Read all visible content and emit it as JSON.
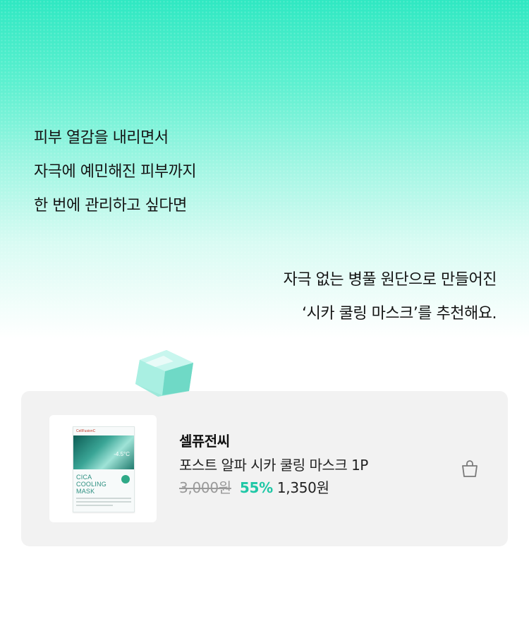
{
  "intro": {
    "line1": "피부 열감을 내리면서",
    "line2": "자극에 예민해진 피부까지",
    "line3": "한 번에 관리하고 싶다면"
  },
  "outro": {
    "line1": "자극 없는 병풀 원단으로 만들어진",
    "line2": "‘시카 쿨링 마스크’를 추천해요."
  },
  "product": {
    "brand": "셀퓨전씨",
    "name": "포스트 알파 시카 쿨링 마스크 1P",
    "original_price": "3,000원",
    "discount": "55%",
    "sale_price": "1,350원",
    "image": {
      "brand_mark": "CellFusionC",
      "temperature": "-4.5°C",
      "name_line1": "CICA",
      "name_line2": "COOLING",
      "name_line3": "MASK"
    }
  },
  "icons": {
    "bag": "shopping-bag-icon",
    "ice": "ice-cube-icon"
  },
  "colors": {
    "accent": "#1fc7a6",
    "hero_top": "#2fe8c2",
    "card_bg": "#f2f2f2"
  }
}
